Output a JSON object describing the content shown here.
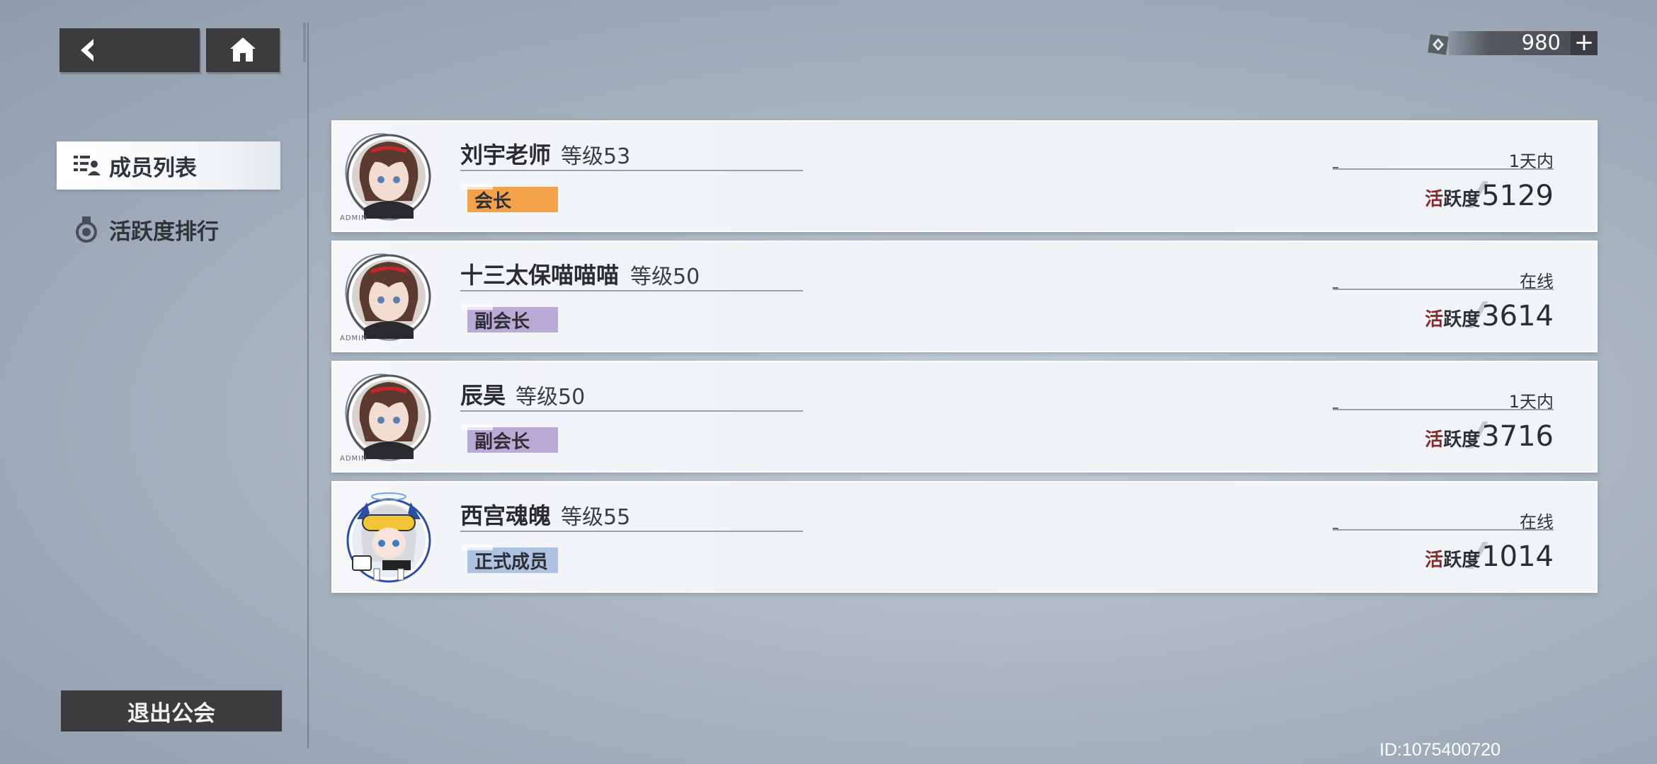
{
  "nav": {
    "items": [
      {
        "label": "成员列表",
        "icon": "member-list-icon",
        "active": true
      },
      {
        "label": "活跃度排行",
        "icon": "medal-icon",
        "active": false
      }
    ],
    "quit_label": "退出公会"
  },
  "currency": {
    "value": "980",
    "plus": "+"
  },
  "members": [
    {
      "name": "刘宇老师",
      "level": "等级53",
      "role": "会长",
      "role_color": "#f4a24a",
      "status": "1天内",
      "activity_label": "活跃度",
      "activity": "5129",
      "avatar": "brown-hair-girl",
      "admin_tag": "ADMIN"
    },
    {
      "name": "十三太保喵喵喵",
      "level": "等级50",
      "role": "副会长",
      "role_color": "#b9abd6",
      "status": "在线",
      "activity_label": "活跃度",
      "activity": "3614",
      "avatar": "brown-hair-girl",
      "admin_tag": "ADMIN"
    },
    {
      "name": "辰昊",
      "level": "等级50",
      "role": "副会长",
      "role_color": "#b9abd6",
      "status": "1天内",
      "activity_label": "活跃度",
      "activity": "3716",
      "avatar": "brown-hair-girl",
      "admin_tag": "ADMIN"
    },
    {
      "name": "西宫魂魄",
      "level": "等级55",
      "role": "正式成员",
      "role_color": "#aec3e2",
      "status": "在线",
      "activity_label": "活跃度",
      "activity": "1014",
      "avatar": "white-hair-goggles-girl",
      "admin_tag": ""
    }
  ],
  "footer": {
    "id": "ID:1075400720"
  }
}
